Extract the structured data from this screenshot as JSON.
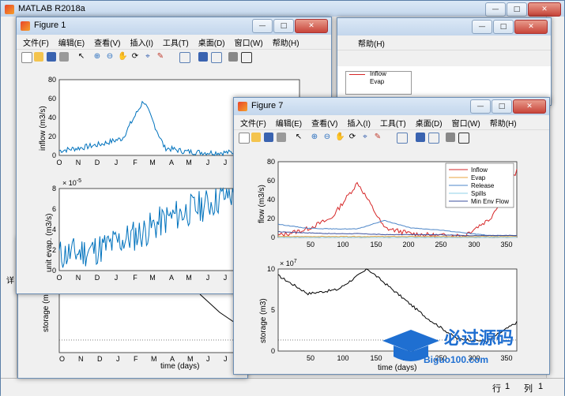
{
  "main_window": {
    "title": "MATLAB R2018a"
  },
  "menu": [
    "文件(F)",
    "编辑(E)",
    "查看(V)",
    "插入(I)",
    "工具(T)",
    "桌面(D)",
    "窗口(W)",
    "帮助(H)"
  ],
  "menu_short": [
    "文件(F)",
    "编辑(E)",
    "查看(V)",
    "插入(I)",
    "工具(T)",
    "桌面(D)",
    "窗口(W)"
  ],
  "menu_help": "帮助(H)",
  "figure1": {
    "title": "Figure 1"
  },
  "figure7": {
    "title": "Figure 7"
  },
  "back_figure": {
    "legend": [
      "Inflow",
      "Evap"
    ]
  },
  "fig1_top": {
    "ylabel": "inflow (m3/s)",
    "yticks": [
      "0",
      "20",
      "40",
      "60",
      "80"
    ],
    "xticks": [
      "O",
      "N",
      "D",
      "J",
      "F",
      "M",
      "A",
      "M",
      "J",
      "J"
    ]
  },
  "fig1_bottom": {
    "ylabel": "unit evap. (m3/s)",
    "exponent_base": "× 10",
    "exponent": "-5",
    "yticks": [
      "0",
      "2",
      "4",
      "6",
      "8"
    ],
    "xticks": [
      "O",
      "N",
      "D",
      "J",
      "F",
      "M",
      "A",
      "M",
      "J",
      "J"
    ]
  },
  "back_storage": {
    "ylabel": "storage (m",
    "xlabel": "time (days)",
    "xticks": [
      "O",
      "N",
      "D",
      "J",
      "F",
      "M",
      "A",
      "M",
      "J",
      "J"
    ]
  },
  "fig7_top": {
    "ylabel": "flow (m3/s)",
    "yticks": [
      "0",
      "20",
      "40",
      "60",
      "80"
    ],
    "xticks": [
      "50",
      "100",
      "150",
      "200",
      "250",
      "300",
      "350"
    ],
    "legend": [
      {
        "label": "Inflow",
        "color": "#d62728"
      },
      {
        "label": "Evap",
        "color": "#e8a33d"
      },
      {
        "label": "Release",
        "color": "#4d86c8"
      },
      {
        "label": "Spills",
        "color": "#8fd0e8"
      },
      {
        "label": "Min Env Flow",
        "color": "#3b4f9e"
      }
    ]
  },
  "fig7_bottom": {
    "ylabel": "storage (m3)",
    "exponent_base": "× 10",
    "exponent": "7",
    "yticks": [
      "0",
      "5",
      "10"
    ],
    "xticks": [
      "50",
      "100",
      "150",
      "200",
      "250",
      "300",
      "350"
    ],
    "xlabel": "time (days)"
  },
  "status": {
    "row_label": "行",
    "row_value": "1",
    "col_label": "列",
    "col_value": "1"
  },
  "watermark": {
    "text": "必过源码",
    "url": "Biguo100.com"
  },
  "left_panel_letter": "详",
  "colors": {
    "matlab_blue": "#0072bd",
    "titlebar": "#c3d6ec",
    "desktop": "#6f9ec3"
  },
  "chart_data": [
    {
      "type": "line",
      "title": "",
      "xlabel": "",
      "ylabel": "inflow (m3/s)",
      "ylim": [
        0,
        80
      ],
      "x": [
        "O",
        "N",
        "D",
        "J",
        "F",
        "M",
        "A",
        "M",
        "J",
        "J"
      ],
      "series": [
        {
          "values": [
            5,
            8,
            12,
            18,
            58,
            8,
            4,
            3,
            3,
            3
          ]
        }
      ]
    },
    {
      "type": "line",
      "title": "",
      "xlabel": "",
      "ylabel": "unit evap. (m3/s)",
      "ylim": [
        0,
        8
      ],
      "x": [
        "O",
        "N",
        "D",
        "J",
        "F",
        "M",
        "A",
        "M",
        "J",
        "J"
      ],
      "series": [
        {
          "values": [
            1.5,
            1.8,
            2.2,
            3.0,
            3.8,
            5.0,
            5.8,
            6.5,
            7.5,
            7.0
          ]
        }
      ]
    },
    {
      "type": "line",
      "title": "",
      "xlabel": "",
      "ylabel": "flow (m3/s)",
      "ylim": [
        0,
        80
      ],
      "x": [
        1,
        50,
        100,
        130,
        150,
        200,
        250,
        300,
        340,
        365
      ],
      "series": [
        {
          "name": "Inflow",
          "values": [
            2,
            8,
            20,
            58,
            10,
            4,
            2,
            2,
            20,
            70
          ]
        },
        {
          "name": "Evap",
          "values": [
            1,
            1,
            1,
            1,
            1,
            1,
            1,
            1,
            1,
            1
          ]
        },
        {
          "name": "Release",
          "values": [
            14,
            10,
            9,
            9,
            18,
            10,
            8,
            5,
            2,
            2
          ]
        },
        {
          "name": "Spills",
          "values": [
            0,
            0,
            0,
            0,
            0,
            0,
            0,
            0,
            0,
            0
          ]
        },
        {
          "name": "Min Env Flow",
          "values": [
            6,
            5,
            4,
            4,
            3,
            3,
            3,
            2,
            2,
            2
          ]
        }
      ]
    },
    {
      "type": "line",
      "title": "",
      "xlabel": "time (days)",
      "ylabel": "storage (m3)",
      "ylim": [
        0,
        10
      ],
      "x": [
        1,
        50,
        100,
        140,
        200,
        250,
        300,
        340,
        365
      ],
      "series": [
        {
          "values": [
            9.2,
            7.0,
            7.5,
            10.0,
            7.0,
            4.0,
            1.5,
            1.2,
            3.5
          ]
        }
      ]
    }
  ]
}
